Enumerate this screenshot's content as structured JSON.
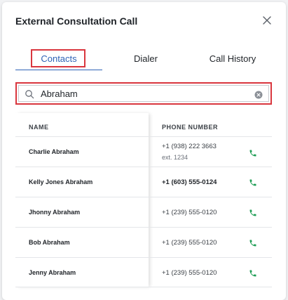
{
  "dialog": {
    "title": "External Consultation Call",
    "close_icon": "close-icon"
  },
  "tabs": [
    {
      "label": "Contacts",
      "active": true
    },
    {
      "label": "Dialer",
      "active": false
    },
    {
      "label": "Call History",
      "active": false
    }
  ],
  "search": {
    "icon": "search-icon",
    "value": "Abraham",
    "clear_icon": "clear-circle-icon"
  },
  "table": {
    "headers": {
      "name": "NAME",
      "phone": "PHONE NUMBER"
    },
    "rows": [
      {
        "name": "Charlie Abraham",
        "phone": "+1 (938) 222 3663",
        "ext": "ext. 1234"
      },
      {
        "name": "Kelly Jones Abraham",
        "phone": "+1 (603) 555-0124"
      },
      {
        "name": "Jhonny Abraham",
        "phone": "+1 (239) 555-0120"
      },
      {
        "name": "Bob Abraham",
        "phone": "+1 (239) 555-0120"
      },
      {
        "name": "Jenny Abraham",
        "phone": "+1 (239) 555-0120"
      }
    ],
    "call_icon": "phone-icon"
  },
  "colors": {
    "accent": "#2f63b6",
    "highlight": "#d9363e",
    "call_green": "#1f9d55"
  }
}
